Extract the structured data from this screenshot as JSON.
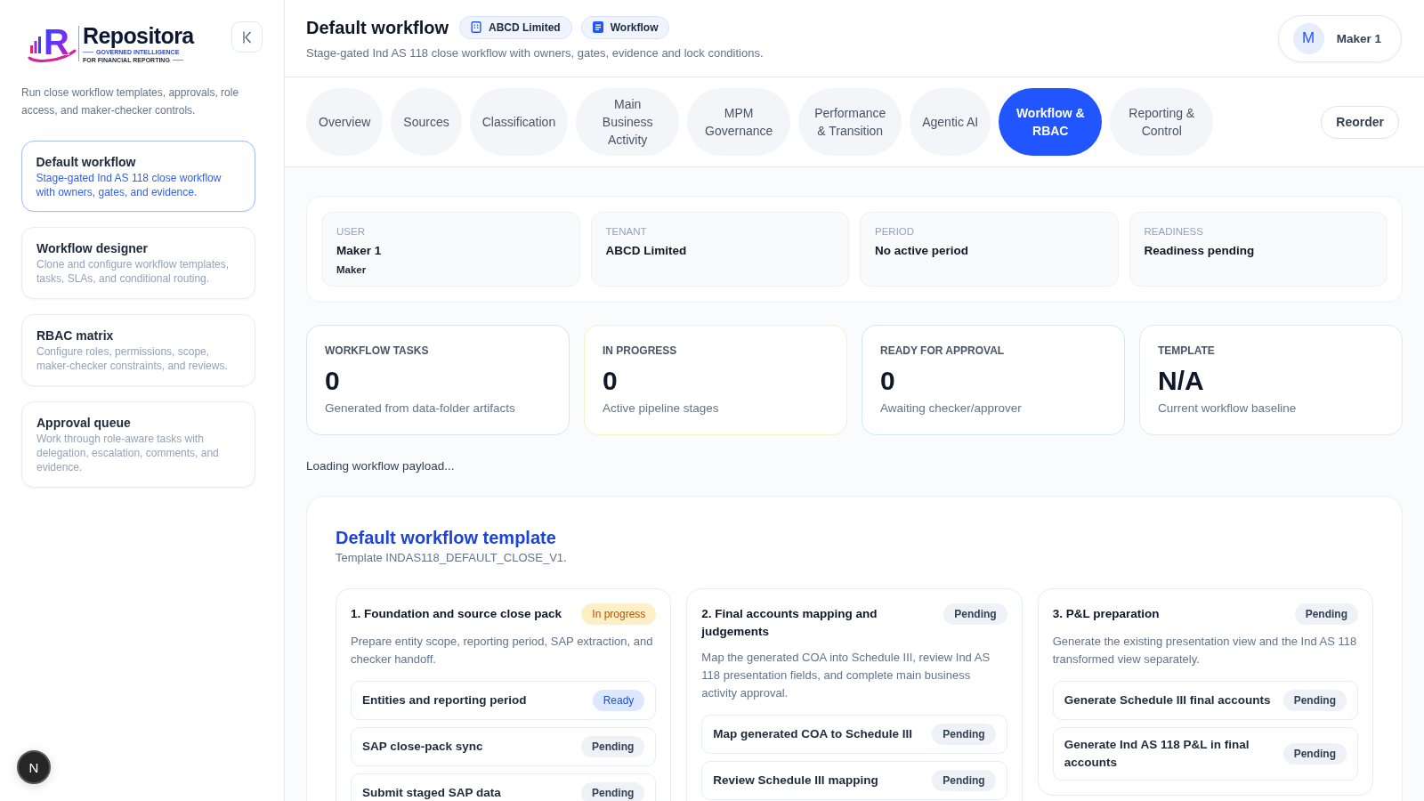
{
  "sidebar": {
    "logo": {
      "mark": "R",
      "name": "Repositora",
      "tagline": [
        "GOVERNED INTELLIGENCE",
        "FOR FINANCIAL REPORTING"
      ]
    },
    "description": "Run close workflow templates, approvals, role access, and maker-checker controls.",
    "items": [
      {
        "title": "Default workflow",
        "description": "Stage-gated Ind AS 118 close workflow with owners, gates, and evidence.",
        "selected": true
      },
      {
        "title": "Workflow designer",
        "description": "Clone and configure workflow templates, tasks, SLAs, and conditional routing.",
        "selected": false
      },
      {
        "title": "RBAC matrix",
        "description": "Configure roles, permissions, scope, maker-checker constraints, and reviews.",
        "selected": false
      },
      {
        "title": "Approval queue",
        "description": "Work through role-aware tasks with delegation, escalation, comments, and evidence.",
        "selected": false
      }
    ]
  },
  "header": {
    "title": "Default workflow",
    "chips": [
      {
        "kind": "tenant",
        "label": "ABCD Limited"
      },
      {
        "kind": "module",
        "label": "Workflow"
      }
    ],
    "subtitle": "Stage-gated Ind AS 118 close workflow with owners, gates, evidence and lock conditions.",
    "user": {
      "initial": "M",
      "name": "Maker 1"
    }
  },
  "tabs": [
    {
      "label": "Overview",
      "selected": false
    },
    {
      "label": "Sources",
      "selected": false
    },
    {
      "label": "Classification",
      "selected": false
    },
    {
      "label": "Main Business Activity",
      "selected": false
    },
    {
      "label": "MPM Governance",
      "selected": false
    },
    {
      "label": "Performance & Transition",
      "selected": false
    },
    {
      "label": "Agentic AI",
      "selected": false
    },
    {
      "label": "Workflow & RBAC",
      "selected": true
    },
    {
      "label": "Reporting & Control",
      "selected": false
    }
  ],
  "reorder_button": "Reorder",
  "context": [
    {
      "label": "USER",
      "value": "Maker 1",
      "detail": "Maker"
    },
    {
      "label": "TENANT",
      "value": "ABCD Limited"
    },
    {
      "label": "PERIOD",
      "value": "No active period"
    },
    {
      "label": "READINESS",
      "value": "Readiness pending"
    }
  ],
  "kpis": [
    {
      "label": "WORKFLOW TASKS",
      "value": "0",
      "description": "Generated from data-folder artifacts",
      "color": "#d9e3f6"
    },
    {
      "label": "IN PROGRESS",
      "value": "0",
      "description": "Active pipeline stages",
      "color": "#fbeec4"
    },
    {
      "label": "READY FOR APPROVAL",
      "value": "0",
      "description": "Awaiting checker/approver",
      "color": "#cdeee6"
    },
    {
      "label": "TEMPLATE",
      "value": "N/A",
      "description": "Current workflow baseline",
      "color": "#e3e8f0"
    }
  ],
  "status_message": "Loading workflow payload...",
  "template": {
    "title": "Default workflow template",
    "subtitle": "Template INDAS118_DEFAULT_CLOSE_V1.",
    "stages": [
      {
        "title": "1. Foundation and source close pack",
        "kind": "progress",
        "status": "In progress",
        "description": "Prepare entity scope, reporting period, SAP extraction, and checker handoff.",
        "tasks": [
          {
            "label": "Entities and reporting period",
            "kind": "ready",
            "status": "Ready"
          },
          {
            "label": "SAP close-pack sync",
            "kind": "pending",
            "status": "Pending"
          },
          {
            "label": "Submit staged SAP data",
            "kind": "pending",
            "status": "Pending"
          }
        ]
      },
      {
        "title": "2. Final accounts mapping and judgements",
        "kind": "pending",
        "status": "Pending",
        "description": "Map the generated COA into Schedule III, review Ind AS 118 presentation fields, and complete main business activity approval.",
        "tasks": [
          {
            "label": "Map generated COA to Schedule III",
            "kind": "pending",
            "status": "Pending"
          },
          {
            "label": "Review Schedule III mapping",
            "kind": "pending",
            "status": "Pending"
          }
        ]
      },
      {
        "title": "3. P&L preparation",
        "kind": "pending",
        "status": "Pending",
        "description": "Generate the existing presentation view and the Ind AS 118 transformed view separately.",
        "tasks": [
          {
            "label": "Generate Schedule III final accounts",
            "kind": "pending",
            "status": "Pending"
          },
          {
            "label": "Generate Ind AS 118 P&L in final accounts",
            "kind": "pending",
            "status": "Pending"
          }
        ]
      }
    ]
  },
  "dev_indicator": "N"
}
